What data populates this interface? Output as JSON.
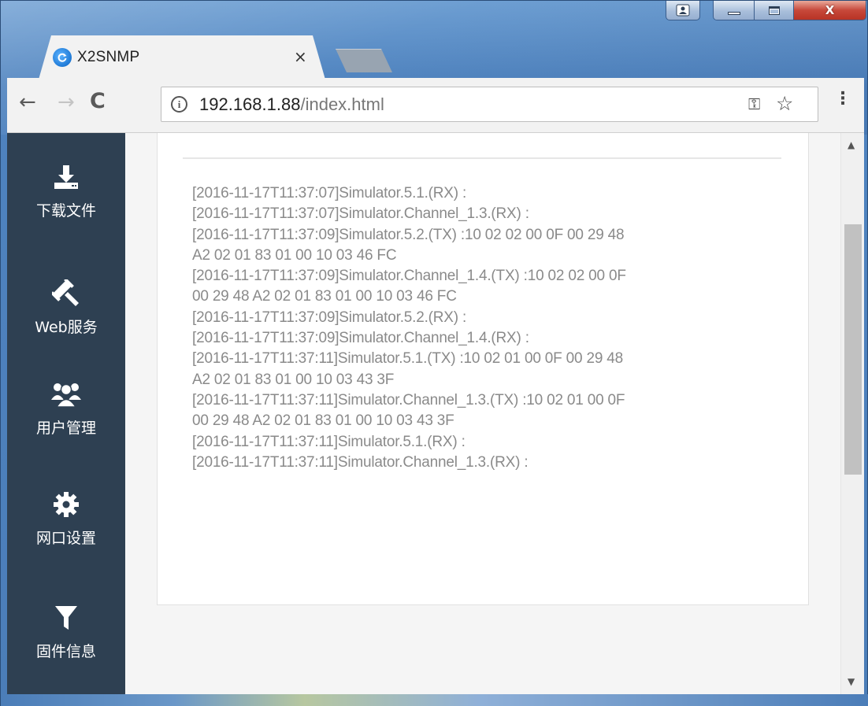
{
  "window": {
    "caption_buttons": [
      "user-icon",
      "minimize",
      "maximize",
      "close"
    ],
    "close_glyph": "X"
  },
  "tab": {
    "title": "X2SNMP",
    "favicon": "x2snmp-logo-icon",
    "close_glyph": "×"
  },
  "toolbar": {
    "back_glyph": "←",
    "forward_glyph": "→",
    "reload_glyph": "C",
    "info_glyph": "i",
    "url_host": "192.168.1.88",
    "url_path": "/index.html",
    "key_glyph": "⚿",
    "star_glyph": "☆",
    "menu_glyph": "⋮"
  },
  "sidebar": {
    "items": [
      {
        "label": "下载文件",
        "icon": "download-icon"
      },
      {
        "label": "Web服务",
        "icon": "gavel-icon"
      },
      {
        "label": "用户管理",
        "icon": "users-icon"
      },
      {
        "label": "网口设置",
        "icon": "gear-icon"
      },
      {
        "label": "固件信息",
        "icon": "filter-icon"
      }
    ]
  },
  "log": {
    "lines": [
      "[2016-11-17T11:37:07]Simulator.5.1.(RX) :",
      "[2016-11-17T11:37:07]Simulator.Channel_1.3.(RX) :",
      "[2016-11-17T11:37:09]Simulator.5.2.(TX) :10 02 02 00 0F 00 29 48",
      "A2 02 01 83 01 00 10 03 46 FC",
      "[2016-11-17T11:37:09]Simulator.Channel_1.4.(TX) :10 02 02 00 0F",
      "00 29 48 A2 02 01 83 01 00 10 03 46 FC",
      "[2016-11-17T11:37:09]Simulator.5.2.(RX) :",
      "[2016-11-17T11:37:09]Simulator.Channel_1.4.(RX) :",
      "[2016-11-17T11:37:11]Simulator.5.1.(TX) :10 02 01 00 0F 00 29 48",
      "A2 02 01 83 01 00 10 03 43 3F",
      "[2016-11-17T11:37:11]Simulator.Channel_1.3.(TX) :10 02 01 00 0F",
      "00 29 48 A2 02 01 83 01 00 10 03 43 3F",
      "[2016-11-17T11:37:11]Simulator.5.1.(RX) :",
      "[2016-11-17T11:37:11]Simulator.Channel_1.3.(RX) :"
    ]
  },
  "scrollbar": {
    "up_glyph": "▲",
    "down_glyph": "▼",
    "position_fraction": 0.16
  },
  "colors": {
    "sidebar_bg": "#2e4052",
    "log_text": "#8a8a8a",
    "page_bg": "#f5f5f5"
  }
}
